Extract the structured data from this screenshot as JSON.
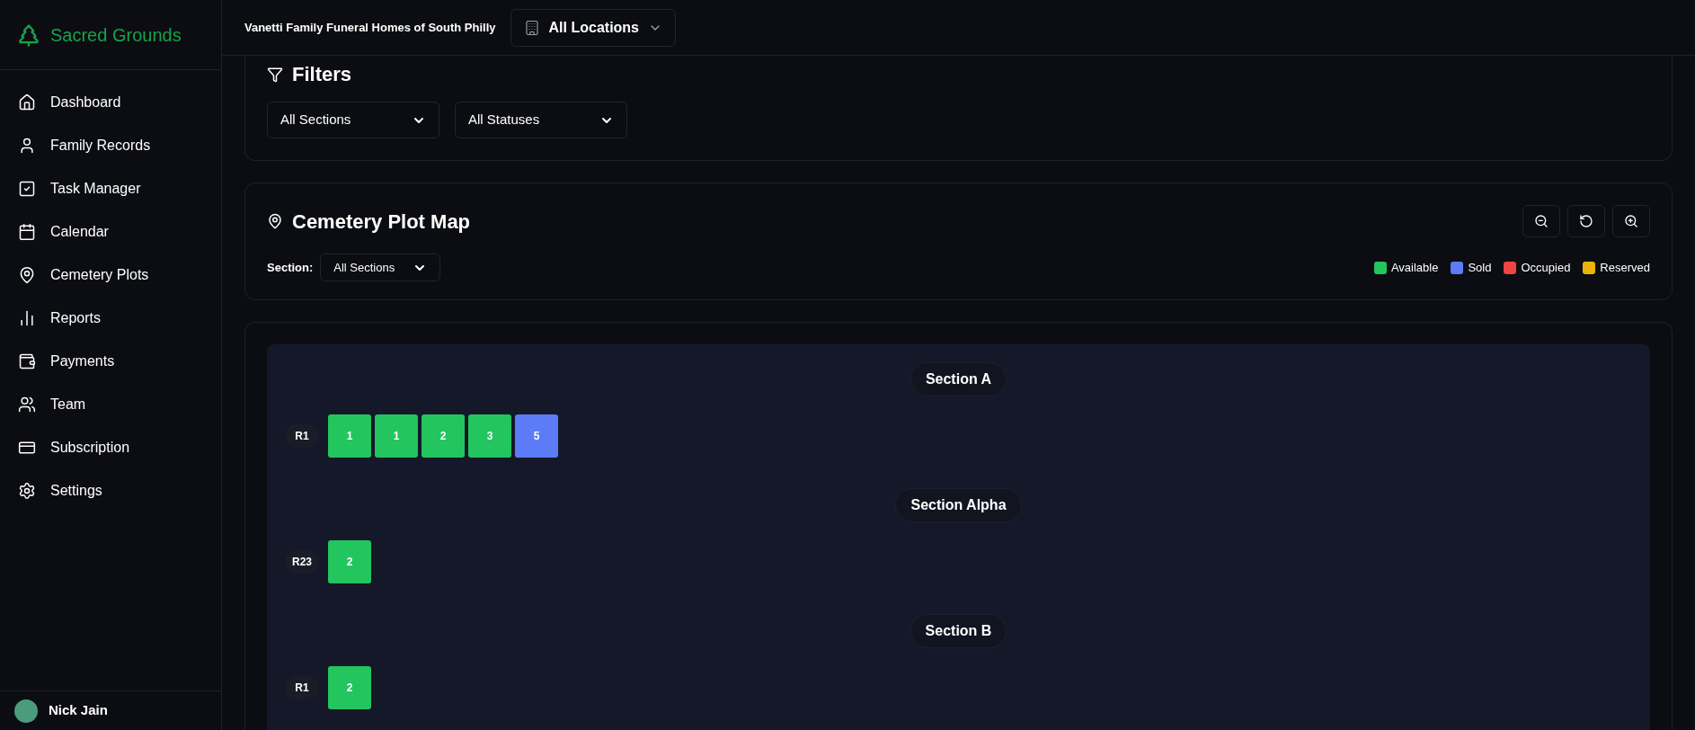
{
  "sidebar": {
    "brand": "Sacred Grounds",
    "items": [
      {
        "label": "Dashboard",
        "selected": false
      },
      {
        "label": "Family Records",
        "selected": false
      },
      {
        "label": "Task Manager",
        "selected": false
      },
      {
        "label": "Calendar",
        "selected": false
      },
      {
        "label": "Cemetery Plots",
        "selected": false
      },
      {
        "label": "Reports",
        "selected": false
      },
      {
        "label": "Payments",
        "selected": false
      },
      {
        "label": "Team",
        "selected": false
      },
      {
        "label": "Subscription",
        "selected": false
      },
      {
        "label": "Settings",
        "selected": false
      }
    ],
    "user": {
      "name": "Nick Jain"
    }
  },
  "header": {
    "organization": "Vanetti Family Funeral Homes of South Philly",
    "location": "All Locations"
  },
  "filters": {
    "title": "Filters",
    "section": "All Sections",
    "status": "All Statuses"
  },
  "plot_map": {
    "title": "Cemetery Plot Map",
    "section_label": "Section:",
    "section_value": "All Sections",
    "legend": [
      {
        "label": "Available",
        "color": "#22c55e"
      },
      {
        "label": "Sold",
        "color": "#5b7cf6"
      },
      {
        "label": "Occupied",
        "color": "#ef4444"
      },
      {
        "label": "Reserved",
        "color": "#eab308"
      }
    ]
  },
  "sections": [
    {
      "name": "Section A",
      "rows": [
        {
          "label": "R1",
          "plots": [
            {
              "number": "1",
              "color": "#22c55e"
            },
            {
              "number": "1",
              "color": "#22c55e"
            },
            {
              "number": "2",
              "color": "#22c55e"
            },
            {
              "number": "3",
              "color": "#22c55e"
            },
            {
              "number": "5",
              "color": "#5b7cf6"
            }
          ]
        }
      ]
    },
    {
      "name": "Section Alpha",
      "rows": [
        {
          "label": "R23",
          "plots": [
            {
              "number": "2",
              "color": "#22c55e"
            }
          ]
        }
      ]
    },
    {
      "name": "Section B",
      "rows": [
        {
          "label": "R1",
          "plots": [
            {
              "number": "2",
              "color": "#22c55e"
            }
          ]
        }
      ]
    }
  ]
}
